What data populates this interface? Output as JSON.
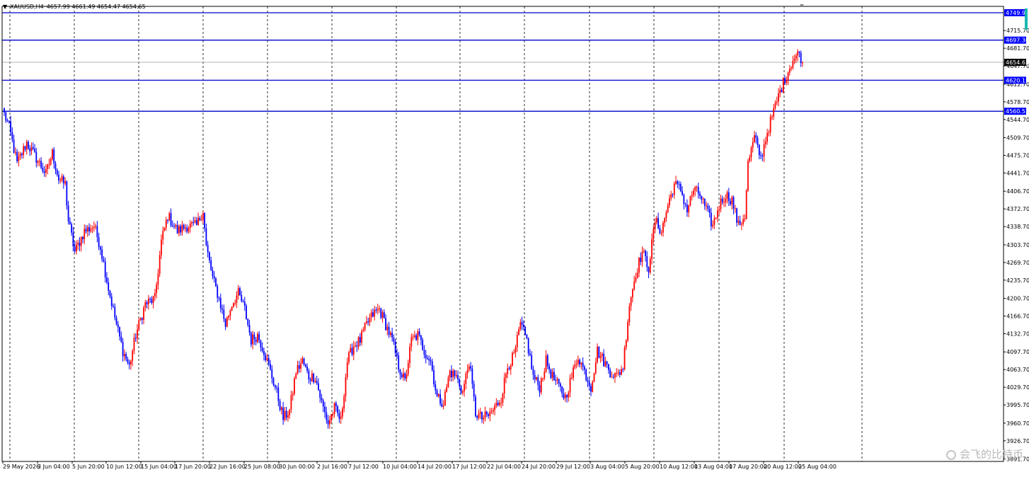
{
  "header": {
    "symbol": "XAUUSD,H4",
    "ohlc": "4657.99 4661.49 4654.47 4654.65"
  },
  "watermark": "会飞的比特币",
  "colors": {
    "bull": "#ff0000",
    "bear": "#0000ff",
    "level_line": "#0000cc",
    "grid": "#000000",
    "label_bg": "#0000ff",
    "label_text": "#ffffff",
    "current_label_bg": "#000000",
    "scroll_accent": "#19b8b0"
  },
  "chart_data": {
    "type": "candlestick",
    "timeframe": "H4",
    "title": "",
    "xlabel": "",
    "ylabel": "",
    "ylim": [
      3891,
      4770
    ],
    "y_ticks": [
      "4715.70",
      "4681.70",
      "4647.70",
      "4612.70",
      "4578.70",
      "4544.70",
      "4509.70",
      "4475.70",
      "4441.70",
      "4406.70",
      "4372.70",
      "4338.70",
      "4303.70",
      "4269.70",
      "4235.70",
      "4200.70",
      "4166.70",
      "4132.70",
      "4097.70",
      "4063.70",
      "4029.70",
      "3995.70",
      "3960.70",
      "3926.70",
      "3891.70"
    ],
    "x_labels": [
      "29 May 2026",
      "3 Jun 04:00",
      "5 Jun 20:00",
      "10 Jun 12:00",
      "15 Jun 04:00",
      "17 Jun 20:00",
      "22 Jun 16:00",
      "25 Jun 08:00",
      "30 Jun 00:00",
      "2 Jul 16:00",
      "7 Jul 12:00",
      "10 Jul 04:00",
      "14 Jul 20:00",
      "17 Jul 12:00",
      "22 Jul 04:00",
      "24 Jul 20:00",
      "29 Jul 12:00",
      "3 Aug 04:00",
      "5 Aug 20:00",
      "10 Aug 12:00",
      "13 Aug 04:00",
      "17 Aug 20:00",
      "20 Aug 12:00",
      "25 Aug 04:00"
    ],
    "horizontal_levels": [
      {
        "price": 4749.97,
        "label": "4749.97"
      },
      {
        "price": 4697.3,
        "label": "4697.30"
      },
      {
        "price": 4620.15,
        "label": "4620.15"
      },
      {
        "price": 4560.53,
        "label": "4560.53"
      }
    ],
    "current_price": {
      "price": 4654.65,
      "label": "4654.65"
    },
    "price_anchors": [
      [
        0,
        4555
      ],
      [
        3,
        4530
      ],
      [
        8,
        4460
      ],
      [
        14,
        4500
      ],
      [
        20,
        4470
      ],
      [
        26,
        4440
      ],
      [
        30,
        4480
      ],
      [
        34,
        4430
      ],
      [
        38,
        4420
      ],
      [
        40,
        4350
      ],
      [
        44,
        4290
      ],
      [
        50,
        4330
      ],
      [
        56,
        4340
      ],
      [
        60,
        4300
      ],
      [
        65,
        4220
      ],
      [
        70,
        4150
      ],
      [
        74,
        4100
      ],
      [
        78,
        4070
      ],
      [
        82,
        4130
      ],
      [
        88,
        4190
      ],
      [
        94,
        4200
      ],
      [
        98,
        4310
      ],
      [
        102,
        4360
      ],
      [
        108,
        4330
      ],
      [
        114,
        4340
      ],
      [
        120,
        4340
      ],
      [
        124,
        4370
      ],
      [
        126,
        4300
      ],
      [
        130,
        4240
      ],
      [
        134,
        4200
      ],
      [
        138,
        4150
      ],
      [
        142,
        4190
      ],
      [
        146,
        4210
      ],
      [
        150,
        4180
      ],
      [
        154,
        4120
      ],
      [
        158,
        4130
      ],
      [
        162,
        4100
      ],
      [
        166,
        4060
      ],
      [
        170,
        4020
      ],
      [
        174,
        3970
      ],
      [
        178,
        3985
      ],
      [
        182,
        4060
      ],
      [
        186,
        4080
      ],
      [
        190,
        4050
      ],
      [
        194,
        4050
      ],
      [
        198,
        4000
      ],
      [
        202,
        3960
      ],
      [
        206,
        3990
      ],
      [
        210,
        3965
      ],
      [
        214,
        4080
      ],
      [
        218,
        4110
      ],
      [
        222,
        4120
      ],
      [
        226,
        4150
      ],
      [
        230,
        4170
      ],
      [
        234,
        4180
      ],
      [
        238,
        4150
      ],
      [
        242,
        4120
      ],
      [
        246,
        4070
      ],
      [
        250,
        4040
      ],
      [
        254,
        4120
      ],
      [
        258,
        4130
      ],
      [
        262,
        4100
      ],
      [
        266,
        4080
      ],
      [
        270,
        4010
      ],
      [
        274,
        4000
      ],
      [
        278,
        4060
      ],
      [
        282,
        4050
      ],
      [
        286,
        4020
      ],
      [
        290,
        4080
      ],
      [
        294,
        3980
      ],
      [
        298,
        3970
      ],
      [
        302,
        3975
      ],
      [
        306,
        3990
      ],
      [
        310,
        4010
      ],
      [
        314,
        4070
      ],
      [
        318,
        4090
      ],
      [
        322,
        4150
      ],
      [
        326,
        4120
      ],
      [
        330,
        4050
      ],
      [
        334,
        4030
      ],
      [
        338,
        4080
      ],
      [
        342,
        4050
      ],
      [
        346,
        4030
      ],
      [
        350,
        4010
      ],
      [
        354,
        4050
      ],
      [
        358,
        4090
      ],
      [
        362,
        4060
      ],
      [
        366,
        4030
      ],
      [
        370,
        4100
      ],
      [
        374,
        4080
      ],
      [
        378,
        4060
      ],
      [
        382,
        4050
      ],
      [
        386,
        4070
      ],
      [
        390,
        4190
      ],
      [
        394,
        4250
      ],
      [
        398,
        4290
      ],
      [
        402,
        4260
      ],
      [
        406,
        4350
      ],
      [
        410,
        4330
      ],
      [
        414,
        4380
      ],
      [
        418,
        4420
      ],
      [
        422,
        4410
      ],
      [
        426,
        4370
      ],
      [
        430,
        4410
      ],
      [
        434,
        4400
      ],
      [
        438,
        4370
      ],
      [
        442,
        4340
      ],
      [
        446,
        4380
      ],
      [
        450,
        4400
      ],
      [
        454,
        4390
      ],
      [
        458,
        4340
      ],
      [
        462,
        4360
      ],
      [
        464,
        4460
      ],
      [
        468,
        4510
      ],
      [
        472,
        4470
      ],
      [
        476,
        4520
      ],
      [
        480,
        4560
      ],
      [
        484,
        4600
      ],
      [
        488,
        4630
      ],
      [
        492,
        4660
      ],
      [
        496,
        4672
      ],
      [
        498,
        4656
      ]
    ]
  }
}
